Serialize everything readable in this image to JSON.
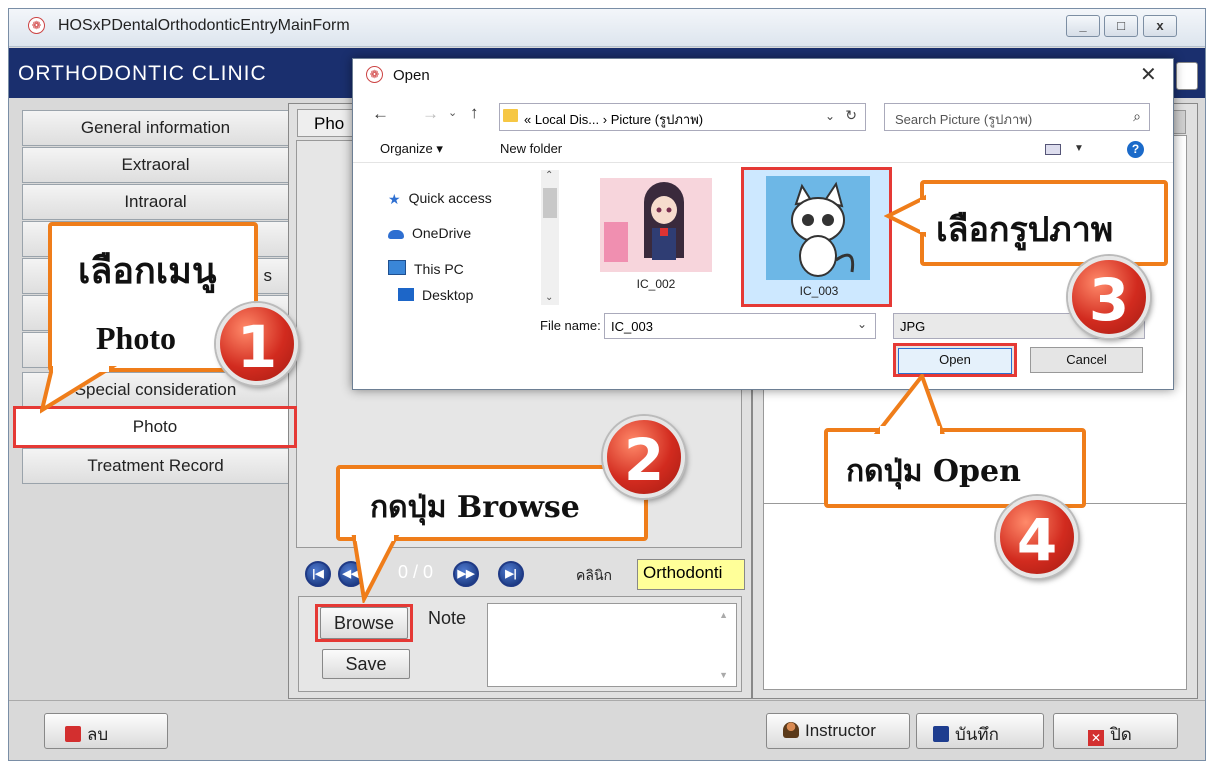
{
  "window": {
    "title": "HOSxPDentalOrthodonticEntryMainForm",
    "controls": [
      "_",
      "□",
      "x"
    ]
  },
  "header": {
    "title": "ORTHODONTIC CLINIC"
  },
  "nav": {
    "items": [
      {
        "label": "General information"
      },
      {
        "label": "Extraoral"
      },
      {
        "label": "Intraoral"
      },
      {
        "label": ""
      },
      {
        "label": "s"
      },
      {
        "label": ""
      },
      {
        "label": ""
      },
      {
        "label": "Special consideration"
      },
      {
        "label": "Photo"
      },
      {
        "label": "Treatment Record"
      }
    ]
  },
  "center": {
    "tab_label": "Pho",
    "pager": "0 / 0",
    "clinic_label": "คลินิก",
    "clinic_value": "Orthodonti",
    "browse_label": "Browse",
    "save_label": "Save",
    "note_label": "Note"
  },
  "bottom": {
    "delete_label": "ลบ",
    "instructor_label": "Instructor",
    "save_label": "บันทึก",
    "close_label": "ปิด"
  },
  "dialog": {
    "title": "Open",
    "close_glyph": "✕",
    "address": "« Local Dis... › Picture (รูปภาพ)",
    "search_placeholder": "Search Picture (รูปภาพ)",
    "organize_label": "Organize ▾",
    "new_folder_label": "New folder",
    "tree": [
      {
        "label": "Quick access",
        "icon": "star-icon"
      },
      {
        "label": "OneDrive",
        "icon": "cloud-icon"
      },
      {
        "label": "This PC",
        "icon": "computer-icon"
      },
      {
        "label": "Desktop",
        "icon": "desktop-icon"
      }
    ],
    "files": [
      {
        "name": "IC_002"
      },
      {
        "name": "IC_003"
      }
    ],
    "file_name_label": "File name:",
    "file_name_value": "IC_003",
    "file_type": "JPG",
    "open_label": "Open",
    "cancel_label": "Cancel"
  },
  "callouts": {
    "step1_text": "เลือกเมนู",
    "step1_sub": "Photo",
    "step2_text": "กดปุ่ม Browse",
    "step3_text": "เลือกรูปภาพ",
    "step4_text": "กดปุ่ม Open",
    "numbers": [
      "1",
      "2",
      "3",
      "4"
    ]
  },
  "colors": {
    "header_bg": "#1a2f6e",
    "callout_border": "#ef7d1a",
    "highlight_red": "#e53935",
    "clinic_field_bg": "#ffff99"
  }
}
